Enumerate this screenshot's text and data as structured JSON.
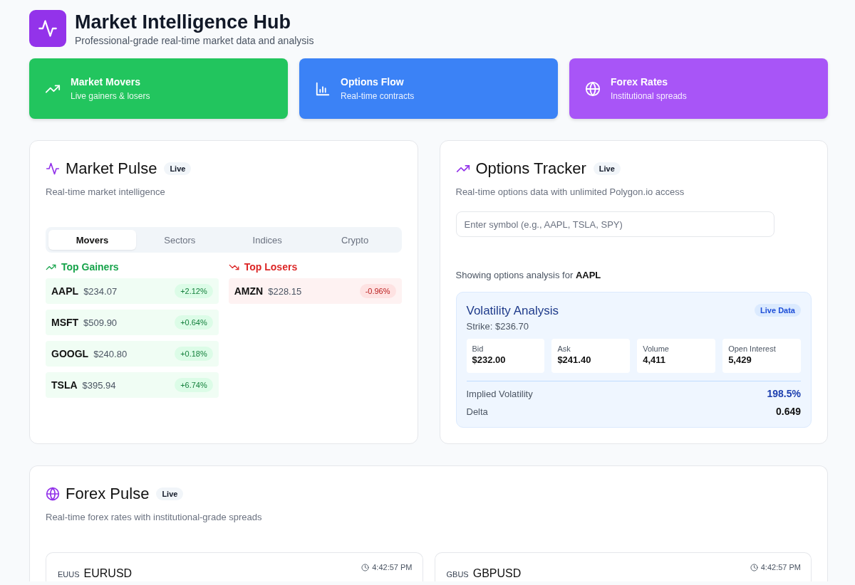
{
  "header": {
    "title": "Market Intelligence Hub",
    "subtitle": "Professional-grade real-time market data and analysis"
  },
  "nav_cards": [
    {
      "kind": "movers",
      "title": "Market Movers",
      "subtitle": "Live gainers & losers",
      "color": "#22c55e"
    },
    {
      "kind": "options",
      "title": "Options Flow",
      "subtitle": "Real-time contracts",
      "color": "#3b82f6"
    },
    {
      "kind": "forex",
      "title": "Forex Rates",
      "subtitle": "Institutional spreads",
      "color": "#a855f7"
    }
  ],
  "market_pulse": {
    "title": "Market Pulse",
    "badge": "Live",
    "subtitle": "Real-time market intelligence",
    "tabs": [
      {
        "label": "Movers",
        "selected": true
      },
      {
        "label": "Sectors",
        "selected": false
      },
      {
        "label": "Indices",
        "selected": false
      },
      {
        "label": "Crypto",
        "selected": false
      }
    ],
    "columns": [
      {
        "kind": "gainers",
        "title": "Top Gainers",
        "rows": [
          {
            "symbol": "AAPL",
            "price": "$234.07",
            "change": "+2.12%"
          },
          {
            "symbol": "MSFT",
            "price": "$509.90",
            "change": "+0.64%"
          },
          {
            "symbol": "GOOGL",
            "price": "$240.80",
            "change": "+0.18%"
          },
          {
            "symbol": "TSLA",
            "price": "$395.94",
            "change": "+6.74%"
          }
        ]
      },
      {
        "kind": "losers",
        "title": "Top Losers",
        "rows": [
          {
            "symbol": "AMZN",
            "price": "$228.15",
            "change": "-0.96%"
          }
        ]
      }
    ]
  },
  "options_tracker": {
    "title": "Options Tracker",
    "badge": "Live",
    "subtitle": "Real-time options data with unlimited Polygon.io access",
    "search": {
      "placeholder": "Enter symbol (e.g., AAPL, TSLA, SPY)"
    },
    "showing": "Showing options analysis for **AAPL**",
    "analysis": {
      "title": "Volatility Analysis",
      "badge": "Live Data",
      "strike": "Strike: $236.70",
      "stats": [
        {
          "label": "Bid",
          "value": "$232.00"
        },
        {
          "label": "Ask",
          "value": "$241.40"
        },
        {
          "label": "Volume",
          "value": "4,411"
        },
        {
          "label": "Open Interest",
          "value": "5,429"
        }
      ],
      "metrics": [
        {
          "kind": "volatility",
          "label": "Implied Volatility",
          "value": "198.5%"
        },
        {
          "kind": "delta",
          "label": "Delta",
          "value": "0.649"
        }
      ]
    }
  },
  "forex_pulse": {
    "title": "Forex Pulse",
    "badge": "Live",
    "subtitle": "Real-time forex rates with institutional-grade spreads",
    "pairs": [
      {
        "code": "EUUS",
        "symbol": "EURUSD",
        "time": "4:42:57 PM"
      },
      {
        "code": "GBUS",
        "symbol": "GBPUSD",
        "time": "4:42:57 PM"
      }
    ]
  }
}
